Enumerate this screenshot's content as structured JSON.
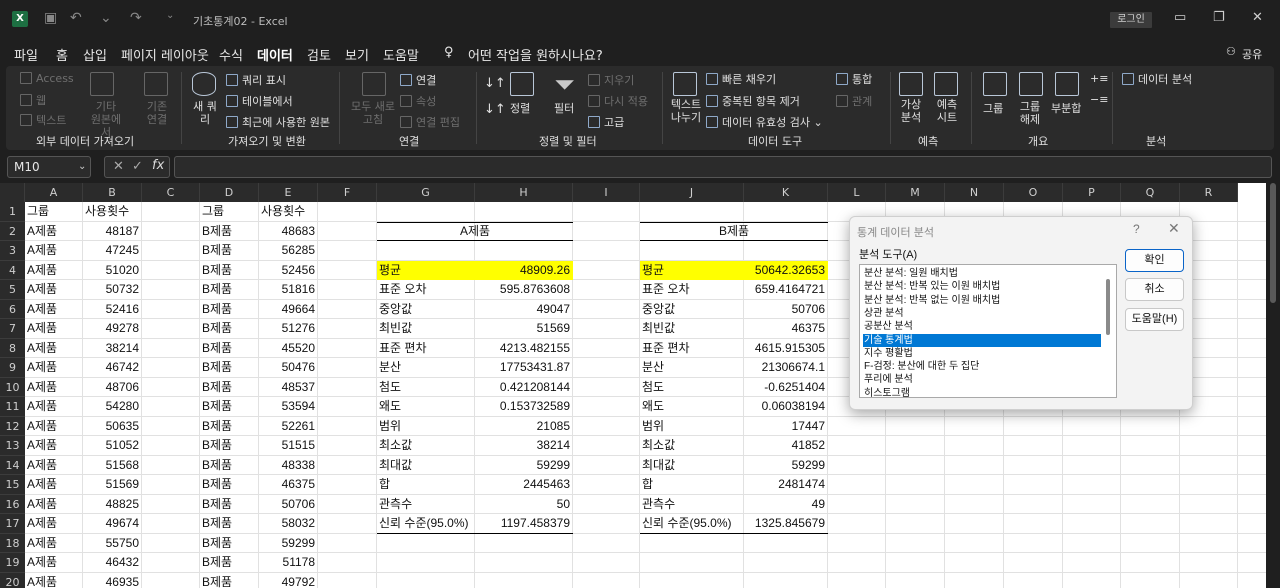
{
  "titlebar": {
    "title": "기초통계02  -  Excel",
    "login": "로그인",
    "min": "—",
    "restore": "❐",
    "close": "✕",
    "save_icon": "save-icon",
    "undo_icon": "undo-icon",
    "redo_icon": "redo-icon"
  },
  "menu": [
    "파일",
    "홈",
    "삽입",
    "페이지 레이아웃",
    "수식",
    "데이터",
    "검토",
    "보기",
    "도움말"
  ],
  "menu_active": "데이터",
  "tell_me": "어떤 작업을 원하시나요?",
  "share": "공유",
  "ribbon": {
    "get_ext": {
      "access": "Access",
      "web": "웹",
      "text": "텍스트",
      "other": "기타 원본에서",
      "existing": "기존 연결",
      "group": "외부 데이터 가져오기"
    },
    "transform": {
      "new_query": "새 쿼리",
      "show_queries": "쿼리 표시",
      "from_table": "테이블에서",
      "recent": "최근에 사용한 원본",
      "group": "가져오기 및 변환"
    },
    "connections": {
      "refresh_all": "모두 새로 고침",
      "connections": "연결",
      "properties": "속성",
      "edit_links": "연결 편집",
      "group": "연결"
    },
    "sort_filter": {
      "sort": "정렬",
      "filter": "필터",
      "clear": "지우기",
      "reapply": "다시 적용",
      "advanced": "고급",
      "group": "정렬 및 필터"
    },
    "data_tools": {
      "text_to_cols": "텍스트 나누기",
      "flash_fill": "빠른 채우기",
      "remove_dup": "중복된 항목 제거",
      "validation": "데이터 유효성 검사",
      "consolidate": "통합",
      "relations": "관계",
      "group": "데이터 도구"
    },
    "forecast": {
      "what_if": "가상 분석",
      "sheet": "예측 시트",
      "group": "예측"
    },
    "outline": {
      "group_btn": "그룹",
      "ungroup": "그룹 해제",
      "subtotal": "부분합",
      "group": "개요"
    },
    "analysis": {
      "data_analysis": "데이터 분석",
      "group": "분석"
    }
  },
  "namebox": "M10",
  "fx": "fx",
  "columns": [
    "A",
    "B",
    "C",
    "D",
    "E",
    "F",
    "G",
    "H",
    "I",
    "J",
    "K",
    "L",
    "M",
    "N",
    "O",
    "P",
    "Q",
    "R"
  ],
  "rows": [
    "1",
    "2",
    "3",
    "4",
    "5",
    "6",
    "7",
    "8",
    "9",
    "10",
    "11",
    "12",
    "13",
    "14",
    "15",
    "16",
    "17",
    "18",
    "19",
    "20"
  ],
  "colA": [
    "그룹",
    "A제품",
    "A제품",
    "A제품",
    "A제품",
    "A제품",
    "A제품",
    "A제품",
    "A제품",
    "A제품",
    "A제품",
    "A제품",
    "A제품",
    "A제품",
    "A제품",
    "A제품",
    "A제품",
    "A제품",
    "A제품",
    "A제품"
  ],
  "colB": [
    "사용횟수",
    "48187",
    "47245",
    "51020",
    "50732",
    "52416",
    "49278",
    "38214",
    "46742",
    "48706",
    "54280",
    "50635",
    "51052",
    "51568",
    "51569",
    "48825",
    "49674",
    "55750",
    "46432",
    "46935"
  ],
  "colD": [
    "그룹",
    "B제품",
    "B제품",
    "B제품",
    "B제품",
    "B제품",
    "B제품",
    "B제품",
    "B제품",
    "B제품",
    "B제품",
    "B제품",
    "B제품",
    "B제품",
    "B제품",
    "B제품",
    "B제품",
    "B제품",
    "B제품",
    "B제품"
  ],
  "colE": [
    "사용횟수",
    "48683",
    "56285",
    "52456",
    "51816",
    "49664",
    "51276",
    "45520",
    "50476",
    "48537",
    "53594",
    "52261",
    "51515",
    "48338",
    "46375",
    "50706",
    "58032",
    "59299",
    "51178",
    "49792"
  ],
  "statA": {
    "title": "A제품",
    "labels": [
      "평균",
      "표준 오차",
      "중앙값",
      "최빈값",
      "표준 편차",
      "분산",
      "첨도",
      "왜도",
      "범위",
      "최소값",
      "최대값",
      "합",
      "관측수",
      "신뢰 수준(95.0%)"
    ],
    "values": [
      "48909.26",
      "595.8763608",
      "49047",
      "51569",
      "4213.482155",
      "17753431.87",
      "0.421208144",
      "0.153732589",
      "21085",
      "38214",
      "59299",
      "2445463",
      "50",
      "1197.458379"
    ]
  },
  "statB": {
    "title": "B제품",
    "labels": [
      "평균",
      "표준 오차",
      "중앙값",
      "최빈값",
      "표준 편차",
      "분산",
      "첨도",
      "왜도",
      "범위",
      "최소값",
      "최대값",
      "합",
      "관측수",
      "신뢰 수준(95.0%)"
    ],
    "values": [
      "50642.32653",
      "659.4164721",
      "50706",
      "46375",
      "4615.915305",
      "21306674.1",
      "-0.6251404",
      "0.06038194",
      "17447",
      "41852",
      "59299",
      "2481474",
      "49",
      "1325.845679"
    ]
  },
  "highlight_color": "#ffff00",
  "dialog": {
    "title": "통계 데이터 분석",
    "help": "?",
    "close": "✕",
    "label": "분석 도구(A)",
    "items": [
      "분산 분석: 일원 배치법",
      "분산 분석: 반복 있는 이원 배치법",
      "분산 분석: 반복 없는 이원 배치법",
      "상관 분석",
      "공분산 분석",
      "기술 통계법",
      "지수 평활법",
      "F-검정: 분산에 대한 두 집단",
      "푸리에 분석",
      "히스토그램"
    ],
    "selected": "기술 통계법",
    "ok": "확인",
    "cancel": "취소",
    "helpbtn": "도움말(H)",
    "accent": "#0078d4"
  }
}
